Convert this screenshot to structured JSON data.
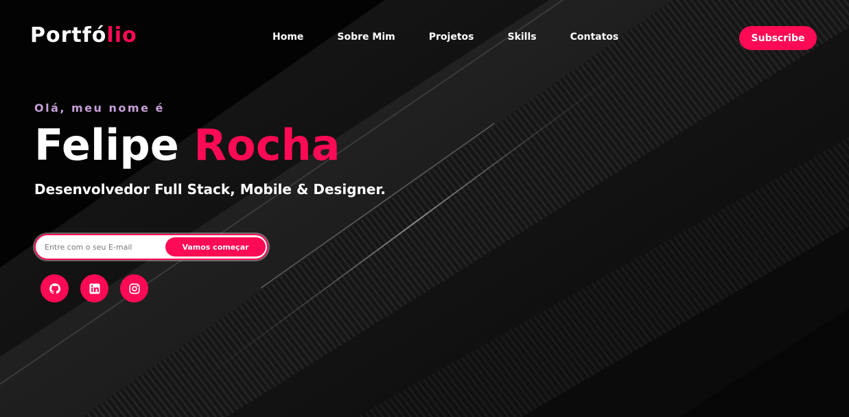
{
  "header": {
    "logo_main": "Portfó",
    "logo_accent": "lio",
    "nav": [
      {
        "label": "Home"
      },
      {
        "label": "Sobre Mim"
      },
      {
        "label": "Projetos"
      },
      {
        "label": "Skills"
      },
      {
        "label": "Contatos"
      }
    ],
    "subscribe_label": "Subscribe"
  },
  "hero": {
    "greeting": "Olá, meu nome é",
    "first_name": "Felipe",
    "last_name": "Rocha",
    "role": "Desenvolvedor Full Stack, Mobile & Designer."
  },
  "email_form": {
    "placeholder": "Entre com o seu E-mail",
    "value": "",
    "button_label": "Vamos começar"
  },
  "socials": [
    {
      "icon": "github-icon"
    },
    {
      "icon": "linkedin-icon"
    },
    {
      "icon": "instagram-icon"
    }
  ],
  "colors": {
    "accent": "#ff0a54",
    "background": "#050505",
    "greeting": "#c69fd8",
    "text": "#ffffff"
  }
}
